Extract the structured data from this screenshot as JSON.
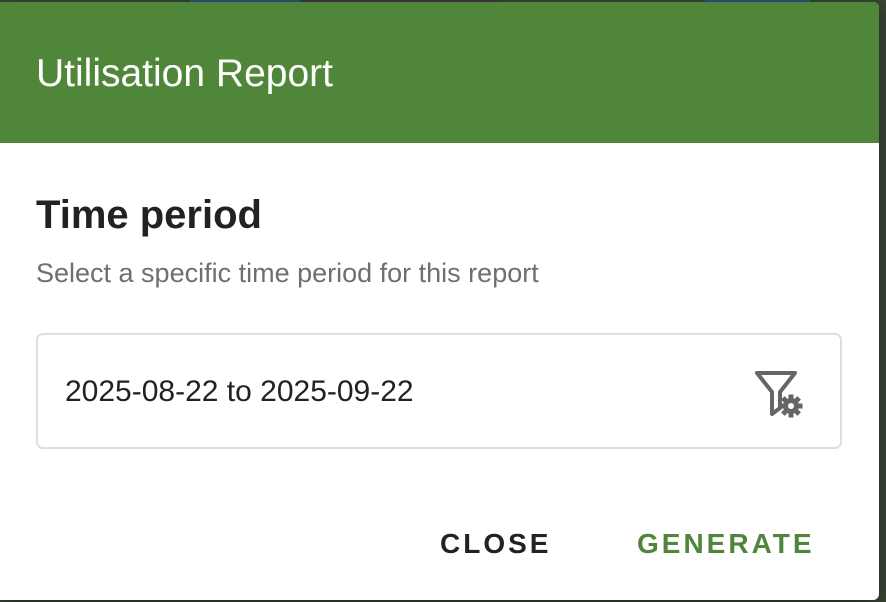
{
  "dialog": {
    "title": "Utilisation Report",
    "header_color": "#4f8639"
  },
  "section": {
    "title": "Time period",
    "subtitle": "Select a specific time period for this report"
  },
  "date_field": {
    "value": "2025-08-22 to 2025-09-22",
    "icon": "filter-settings-icon"
  },
  "actions": {
    "close_label": "CLOSE",
    "generate_label": "GENERATE",
    "accent_color": "#4f8639"
  }
}
